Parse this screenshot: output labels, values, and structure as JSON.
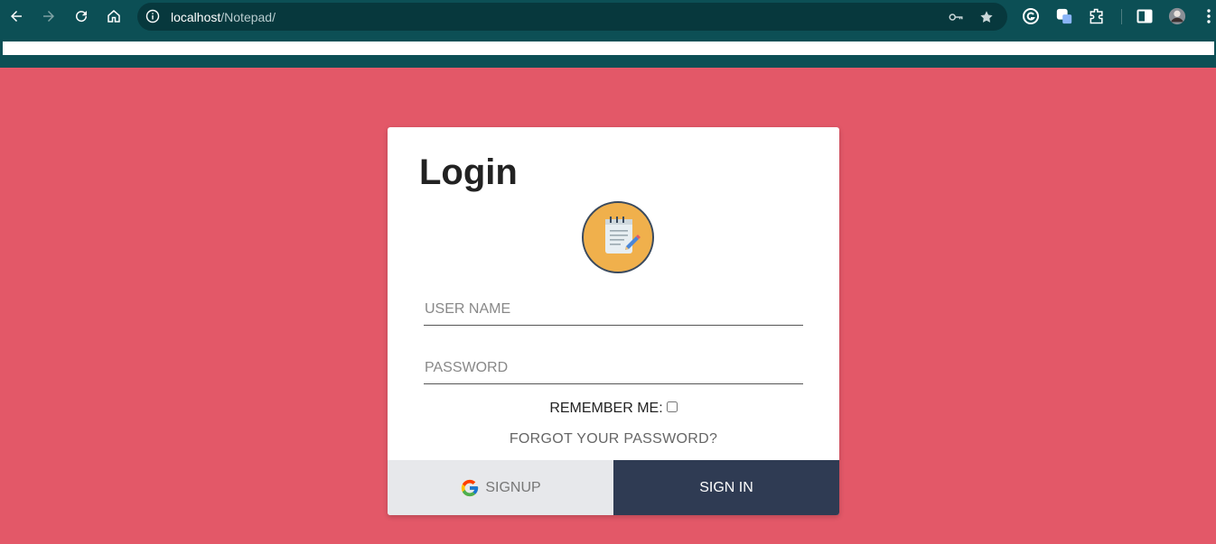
{
  "browser": {
    "url_host": "localhost",
    "url_path": "/Notepad/",
    "icons": [
      "back-icon",
      "forward-icon",
      "reload-icon",
      "home-icon",
      "site-info-icon",
      "key-icon",
      "star-icon",
      "grammarly-icon",
      "extension-app-icon",
      "puzzle-icon",
      "side-panel-icon",
      "profile-avatar",
      "menu-icon"
    ]
  },
  "login": {
    "title": "Login",
    "username_placeholder": "USER NAME",
    "password_placeholder": "PASSWORD",
    "remember_label": "REMEMBER ME:",
    "forgot_label": "FORGOT YOUR PASSWORD?",
    "signup_label": "SIGNUP",
    "signin_label": "SIGN IN"
  },
  "colors": {
    "page_background": "#e35868",
    "chrome": "#0c4f55",
    "signin_button": "#2f3b53",
    "signup_button": "#e7e8eb"
  }
}
